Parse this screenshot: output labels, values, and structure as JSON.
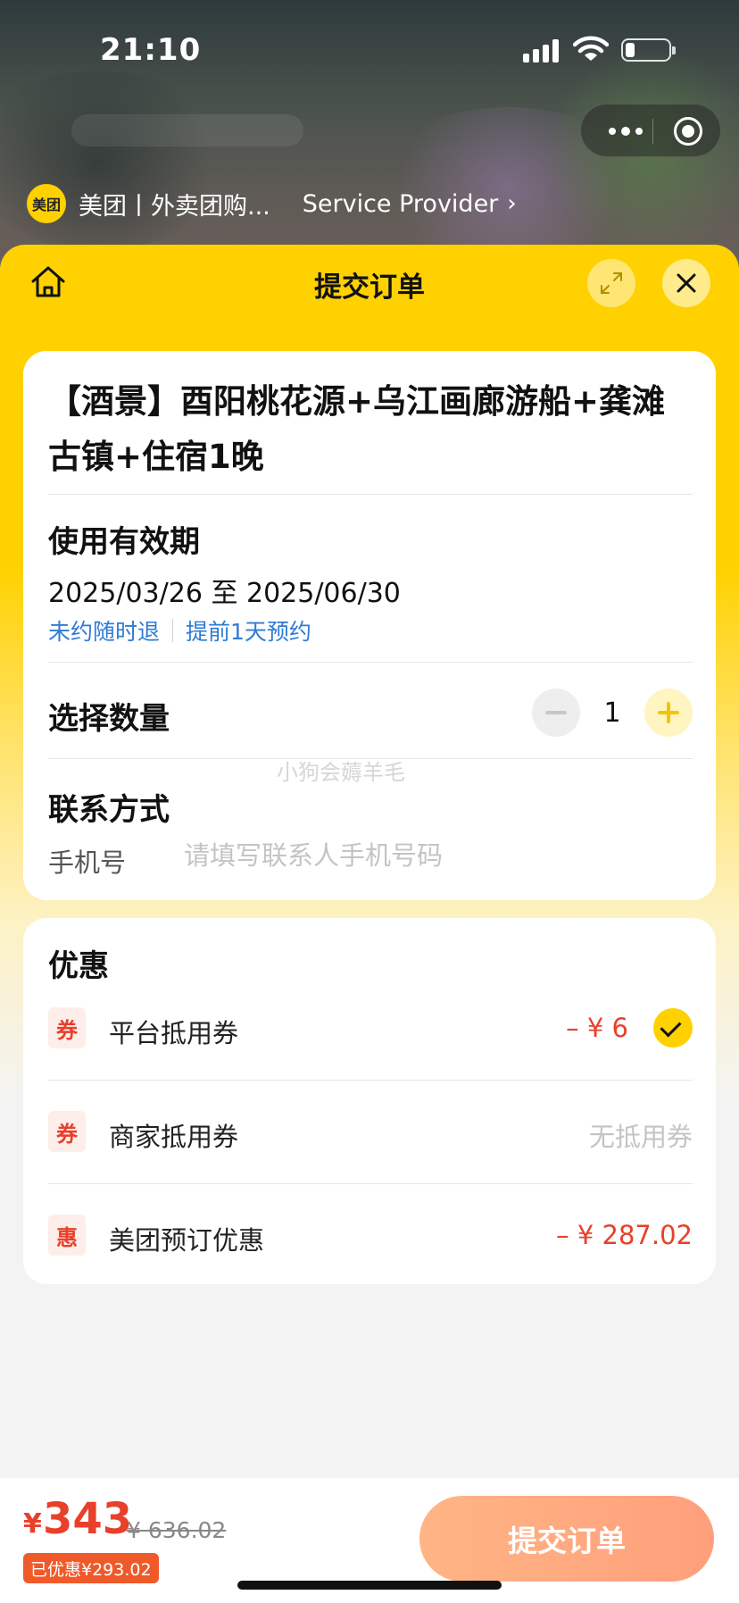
{
  "status_bar": {
    "time": "21:10"
  },
  "provider": {
    "logo_text": "美团",
    "name": "美团丨外卖团购...",
    "link": "Service Provider",
    "chevron": "›"
  },
  "sheet": {
    "title": "提交订单"
  },
  "product": {
    "title": "【酒景】酉阳桃花源+乌江画廊游船+龚滩古镇+住宿1晚"
  },
  "validity": {
    "label": "使用有效期",
    "date_range": "2025/03/26 至 2025/06/30",
    "tags": [
      "未约随时退",
      "提前1天预约"
    ]
  },
  "quantity": {
    "label": "选择数量",
    "value": "1"
  },
  "watermark": "小狗会薅羊毛",
  "contact": {
    "label": "联系方式",
    "phone_label": "手机号",
    "phone_placeholder": "请填写联系人手机号码",
    "phone_value": ""
  },
  "discounts": {
    "title": "优惠",
    "items": [
      {
        "badge": "券",
        "name": "平台抵用券",
        "amount": "– ¥ 6",
        "checked": true
      },
      {
        "badge": "券",
        "name": "商家抵用券",
        "amount": "无抵用券",
        "checked": false
      },
      {
        "badge": "惠",
        "name": "美团预订优惠",
        "amount": "– ¥ 287.02",
        "checked": false
      }
    ]
  },
  "footer": {
    "currency": "¥",
    "price": "343",
    "original_price": "¥ 636.02",
    "saved": "已优惠¥293.02",
    "submit_label": "提交订单"
  },
  "colors": {
    "brand_yellow": "#ffd100",
    "price_red": "#e8402a",
    "link_blue": "#2f7bd6",
    "submit_gradient": [
      "#ffb585",
      "#ff9f7c"
    ]
  },
  "icons": [
    "cellular-signal-icon",
    "wifi-icon",
    "battery-icon",
    "more-dots-icon",
    "target-icon",
    "home-icon",
    "expand-icon",
    "close-icon",
    "check-icon",
    "minus-icon",
    "plus-icon"
  ]
}
